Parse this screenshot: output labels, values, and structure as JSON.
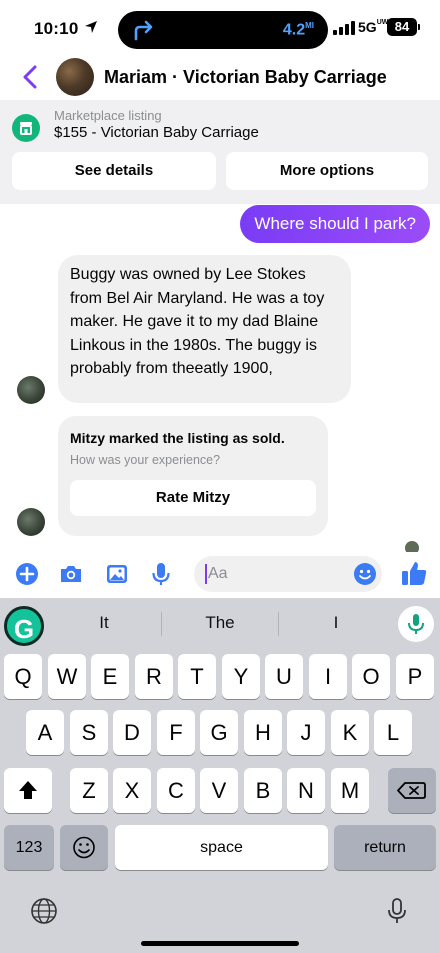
{
  "status_bar": {
    "time": "10:10",
    "distance": "4.2",
    "distance_unit": "MI",
    "network": "5G",
    "network_sub": "UW",
    "battery": "84"
  },
  "header": {
    "title": "Mariam · Victorian Baby Carriage"
  },
  "listing": {
    "label": "Marketplace listing",
    "price_title": "$155 - Victorian Baby Carriage",
    "see_details": "See details",
    "more_options": "More options"
  },
  "chat": {
    "sent_message": "Where should I park?",
    "received_message": "Buggy was owned by Lee Stokes from Bel Air Maryland.   He was a toy maker.   He gave it to my dad Blaine Linkous in the 1980s.   The buggy is probably from theeatly 1900,",
    "sold_title": "Mitzy marked the listing as sold.",
    "sold_subtitle": "How was your experience?",
    "rate_button": "Rate Mitzy"
  },
  "composer": {
    "placeholder": "Aa"
  },
  "keyboard": {
    "grammarly": "G",
    "suggestions": [
      "It",
      "The",
      "I"
    ],
    "row1": [
      "Q",
      "W",
      "E",
      "R",
      "T",
      "Y",
      "U",
      "I",
      "O",
      "P"
    ],
    "row2": [
      "A",
      "S",
      "D",
      "F",
      "G",
      "H",
      "J",
      "K",
      "L"
    ],
    "row3": [
      "Z",
      "X",
      "C",
      "V",
      "B",
      "N",
      "M"
    ],
    "numbers_key": "123",
    "space_key": "space",
    "return_key": "return"
  },
  "colors": {
    "accent": "#7a3cf6",
    "icon_blue": "#3b7bf6",
    "marketplace_green": "#13b67a",
    "grammarly_green": "#15c39a"
  }
}
